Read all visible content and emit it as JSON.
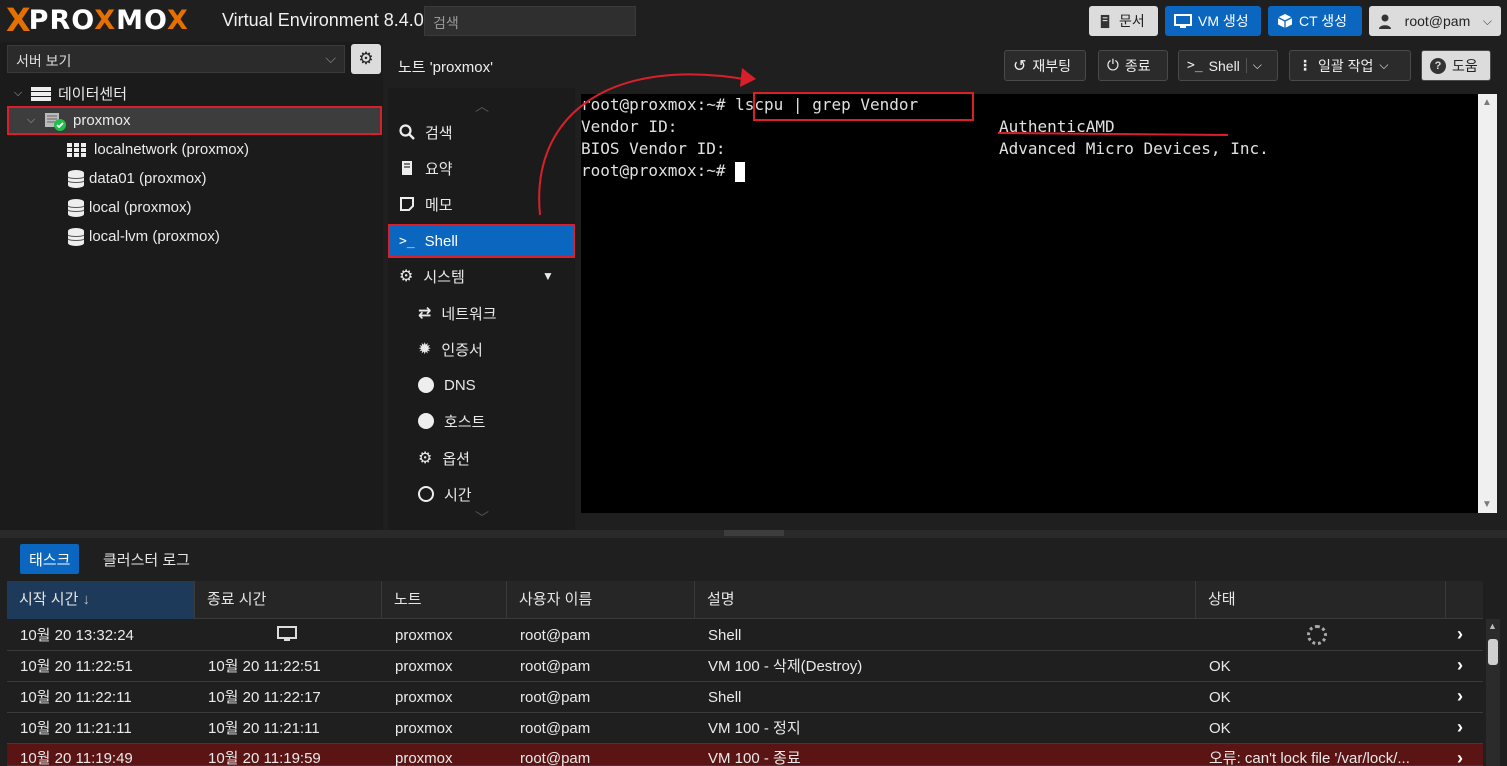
{
  "topbar": {
    "logo_x": "X",
    "logo_text": "PROXMOX",
    "version": "Virtual Environment 8.4.0",
    "search_placeholder": "검색",
    "docs_label": "문서",
    "create_vm_label": "VM 생성",
    "create_ct_label": "CT 생성",
    "user_label": "root@pam"
  },
  "tree": {
    "view_label": "서버 보기",
    "items": [
      {
        "label": "데이터센터",
        "icon": "datacenter-icon"
      },
      {
        "label": "proxmox",
        "icon": "node-online-icon"
      },
      {
        "label": "localnetwork (proxmox)",
        "icon": "sdn-grid-icon"
      },
      {
        "label": "data01 (proxmox)",
        "icon": "storage-icon"
      },
      {
        "label": "local (proxmox)",
        "icon": "storage-icon"
      },
      {
        "label": "local-lvm (proxmox)",
        "icon": "storage-icon"
      }
    ]
  },
  "nodebar": {
    "title": "노트 'proxmox'",
    "reboot_label": "재부팅",
    "shutdown_label": "종료",
    "shell_label": "Shell",
    "bulk_label": "일괄 작업",
    "help_label": "도움"
  },
  "nav": {
    "items": [
      {
        "label": "검색",
        "icon": "search-icon"
      },
      {
        "label": "요약",
        "icon": "book-icon"
      },
      {
        "label": "메모",
        "icon": "note-icon"
      },
      {
        "label": "Shell",
        "icon": "terminal-icon"
      },
      {
        "label": "시스템",
        "icon": "cogs-icon"
      },
      {
        "label": "네트워크",
        "icon": "exchange-icon"
      },
      {
        "label": "인증서",
        "icon": "certificate-icon"
      },
      {
        "label": "DNS",
        "icon": "globe-icon"
      },
      {
        "label": "호스트",
        "icon": "globe-icon"
      },
      {
        "label": "옵션",
        "icon": "gear-icon"
      },
      {
        "label": "시간",
        "icon": "clock-icon"
      }
    ]
  },
  "terminal": {
    "line1_prompt": "root@proxmox:~# ",
    "line1_cmd": "lscpu | grep Vendor",
    "line2_key": "Vendor ID:",
    "line2_val": "AuthenticAMD",
    "line3_key": "BIOS Vendor ID:",
    "line3_val": "Advanced Micro Devices, Inc.",
    "line4_prompt": "root@proxmox:~# "
  },
  "tasks": {
    "tab_tasks": "태스크",
    "tab_cluster_log": "클러스터 로그",
    "columns": [
      "시작 시간",
      "종료 시간",
      "노트",
      "사용자 이름",
      "설명",
      "상태"
    ],
    "sort_indicator": "↓",
    "rows": [
      {
        "start": "10월 20 13:32:24",
        "end": "",
        "node": "proxmox",
        "user": "root@pam",
        "desc": "Shell",
        "status": ""
      },
      {
        "start": "10월 20 11:22:51",
        "end": "10월 20 11:22:51",
        "node": "proxmox",
        "user": "root@pam",
        "desc": "VM 100 - 삭제(Destroy)",
        "status": "OK"
      },
      {
        "start": "10월 20 11:22:11",
        "end": "10월 20 11:22:17",
        "node": "proxmox",
        "user": "root@pam",
        "desc": "Shell",
        "status": "OK"
      },
      {
        "start": "10월 20 11:21:11",
        "end": "10월 20 11:21:11",
        "node": "proxmox",
        "user": "root@pam",
        "desc": "VM 100 - 정지",
        "status": "OK"
      },
      {
        "start": "10월 20 11:19:49",
        "end": "10월 20 11:19:59",
        "node": "proxmox",
        "user": "root@pam",
        "desc": "VM 100 - 종료",
        "status": "오류: can't lock file '/var/lock/..."
      }
    ]
  },
  "colors": {
    "accent": "#0b66c0",
    "brand_orange": "#e57000",
    "highlight_red": "#d9202a",
    "error_row": "#5a1414"
  }
}
